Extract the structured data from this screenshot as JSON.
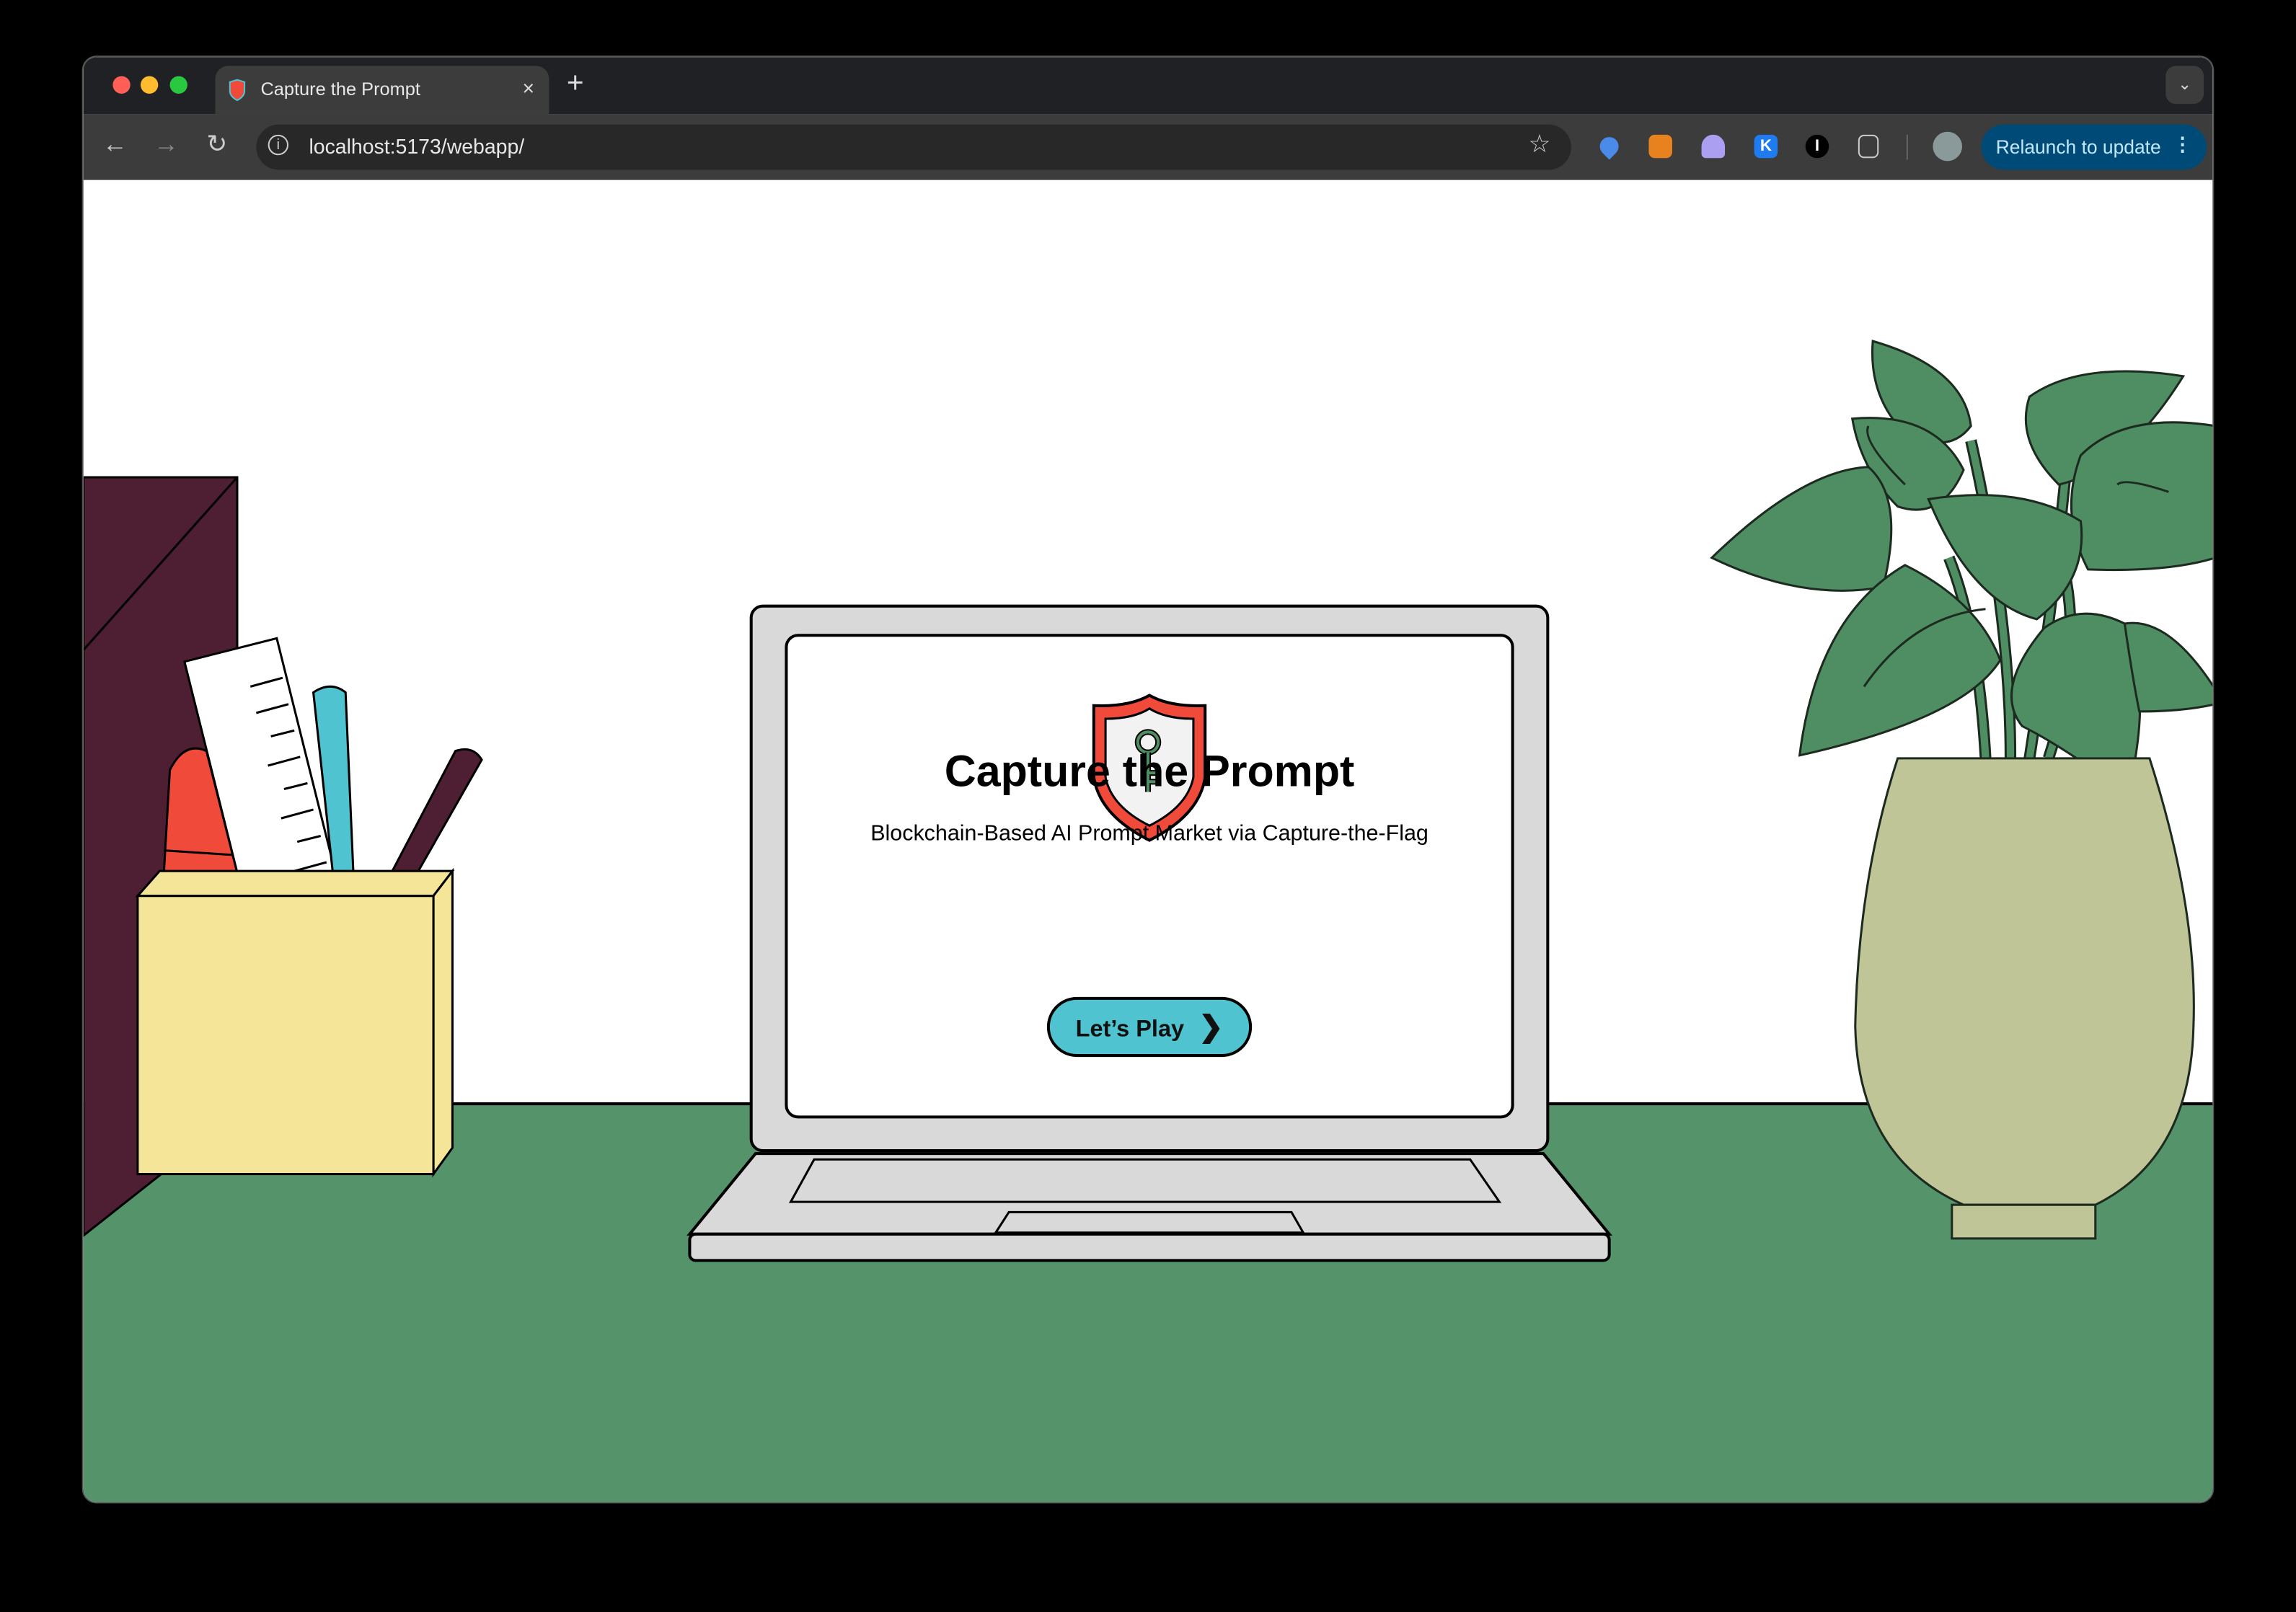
{
  "browser": {
    "tab_title": "Capture the Prompt",
    "tab_close": "×",
    "new_tab": "+",
    "tab_dropdown": "⌄",
    "url": "localhost:5173/webapp/",
    "relaunch_label": "Relaunch to update",
    "menu_dots": "⋮",
    "extensions": [
      "extension-blue-drop-icon",
      "metamask-fox-icon",
      "ghost-icon",
      "k-icon",
      "i-icon",
      "puzzle-icon"
    ],
    "ext_k": "K",
    "ext_i": "I"
  },
  "hero": {
    "title": "Capture the Prompt",
    "subtitle": "Blockchain-Based AI Prompt Market via Capture-the-Flag",
    "button_label": "Let’s Play",
    "button_chevron": "❯"
  },
  "colors": {
    "desk": "#55936b",
    "accent_button": "#4fc3d0",
    "shield_red": "#f04a3a",
    "relaunch_bg": "#004a77",
    "pot": "#bfc596",
    "leaf": "#4f8d62",
    "cup": "#f5e599",
    "maroon": "#4e1f33"
  }
}
